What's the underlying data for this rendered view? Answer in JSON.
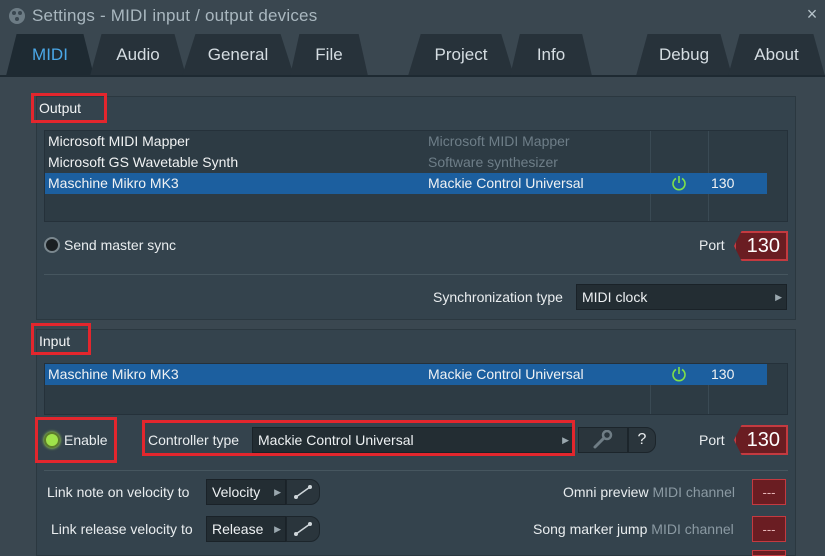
{
  "window": {
    "title": "Settings - MIDI input / output devices",
    "close_symbol": "×"
  },
  "tabs": [
    {
      "label": "MIDI",
      "active": true
    },
    {
      "label": "Audio"
    },
    {
      "label": "General"
    },
    {
      "label": "File"
    },
    {
      "label": "Project"
    },
    {
      "label": "Info"
    },
    {
      "label": "Debug"
    },
    {
      "label": "About"
    }
  ],
  "output": {
    "label": "Output",
    "devices": [
      {
        "name": "Microsoft MIDI Mapper",
        "controller": "Microsoft MIDI Mapper",
        "port": ""
      },
      {
        "name": "Microsoft GS Wavetable Synth",
        "controller": "Software synthesizer",
        "port": ""
      },
      {
        "name": "Maschine Mikro MK3",
        "controller": "Mackie Control Universal",
        "port": "130",
        "selected": true
      }
    ],
    "send_master_sync_label": "Send master sync",
    "port_label": "Port",
    "port_value": "130",
    "sync_type_label": "Synchronization type",
    "sync_type_value": "MIDI clock"
  },
  "input": {
    "label": "Input",
    "devices": [
      {
        "name": "Maschine Mikro MK3",
        "controller": "Mackie Control Universal",
        "port": "130",
        "selected": true
      }
    ],
    "enable_label": "Enable",
    "controller_type_label": "Controller type",
    "controller_type_value": "Mackie Control Universal",
    "help_symbol": "?",
    "port_label": "Port",
    "port_value": "130"
  },
  "links": {
    "link_note_label": "Link note on velocity to",
    "link_note_value": "Velocity",
    "link_release_label": "Link release velocity to",
    "link_release_value": "Release",
    "omni_preview_label": "Omni preview",
    "song_marker_label": "Song marker jump",
    "midi_channel_label": "MIDI channel",
    "channel_value": "---"
  },
  "colors": {
    "accent_tab": "#4aa8e8",
    "selection": "#1c5f9f",
    "port_bg": "#6a1d22",
    "highlight_box": "#e3262d",
    "power_green": "#7fe04a"
  }
}
